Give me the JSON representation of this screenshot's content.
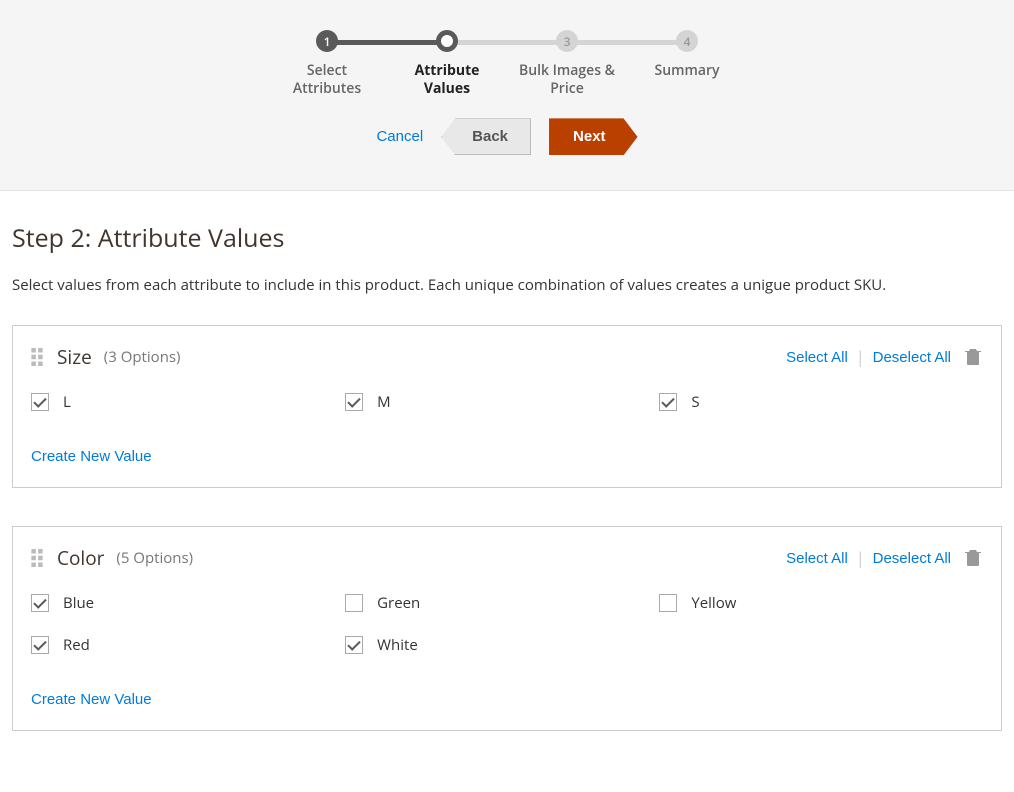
{
  "wizard": {
    "steps": [
      {
        "number": "1",
        "label": "Select\nAttributes",
        "state": "completed"
      },
      {
        "number": "",
        "label": "Attribute\nValues",
        "state": "active"
      },
      {
        "number": "3",
        "label": "Bulk Images &\nPrice",
        "state": "pending"
      },
      {
        "number": "4",
        "label": "Summary",
        "state": "pending"
      }
    ],
    "cancel": "Cancel",
    "back": "Back",
    "next": "Next"
  },
  "title": "Step 2: Attribute Values",
  "description": "Select values from each attribute to include in this product. Each unique combination of values creates a unigue product SKU.",
  "actions": {
    "select_all": "Select All",
    "deselect_all": "Deselect All",
    "create_new": "Create New Value"
  },
  "attributes": [
    {
      "name": "Size",
      "count_label": "(3 Options)",
      "options": [
        {
          "label": "L",
          "checked": true
        },
        {
          "label": "M",
          "checked": true
        },
        {
          "label": "S",
          "checked": true
        }
      ]
    },
    {
      "name": "Color",
      "count_label": "(5 Options)",
      "options": [
        {
          "label": "Blue",
          "checked": true
        },
        {
          "label": "Green",
          "checked": false
        },
        {
          "label": "Yellow",
          "checked": false
        },
        {
          "label": "Red",
          "checked": true
        },
        {
          "label": "White",
          "checked": true
        }
      ]
    }
  ]
}
